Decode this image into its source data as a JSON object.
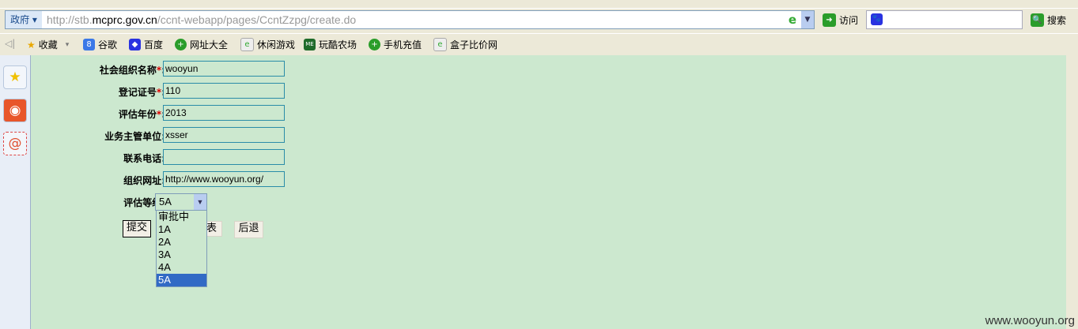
{
  "address_bar": {
    "scope": "政府",
    "url_prefix": "http://stb.",
    "url_domain": "mcprc.gov.cn",
    "url_path": "/ccnt-webapp/pages/CcntZzpg/create.do",
    "go_label": "访问",
    "search_label": "搜索",
    "search_value": ""
  },
  "favorites": {
    "collect_label": "收藏",
    "items": [
      {
        "label": "谷歌",
        "icon": "google-icon",
        "color": "#3b78e7"
      },
      {
        "label": "百度",
        "icon": "baidu-icon",
        "color": "#2932e1"
      },
      {
        "label": "网址大全",
        "icon": "plus-icon",
        "color": "#2a9d2a"
      },
      {
        "label": "休闲游戏",
        "icon": "ie-page-icon",
        "color": "#7a9"
      },
      {
        "label": "玩酷农场",
        "icon": "me-icon",
        "color": "#1f6b2a"
      },
      {
        "label": "手机充值",
        "icon": "plus-icon",
        "color": "#2a9d2a"
      },
      {
        "label": "盒子比价网",
        "icon": "ie-page-icon",
        "color": "#7a9"
      }
    ]
  },
  "form": {
    "fields": [
      {
        "label": "社会组织名称",
        "required": "*",
        "value": "wooyun"
      },
      {
        "label": "登记证号",
        "required": "*",
        "value": "110"
      },
      {
        "label": "评估年份",
        "required": "*",
        "value": "2013"
      },
      {
        "label": "业务主管单位",
        "required": "",
        "value": "xsser"
      },
      {
        "label": "联系电话",
        "required": "",
        "value": ""
      },
      {
        "label": "组织网址",
        "required": "",
        "value": "http://www.wooyun.org/"
      }
    ],
    "colon": ":",
    "grade_label": "评估等级:",
    "grade_value": "5A",
    "grade_options": [
      "审批中",
      "1A",
      "2A",
      "3A",
      "4A",
      "5A"
    ],
    "submit": "提交",
    "middle_fragment": "表",
    "back": "后退"
  },
  "watermark": "www.wooyun.org"
}
